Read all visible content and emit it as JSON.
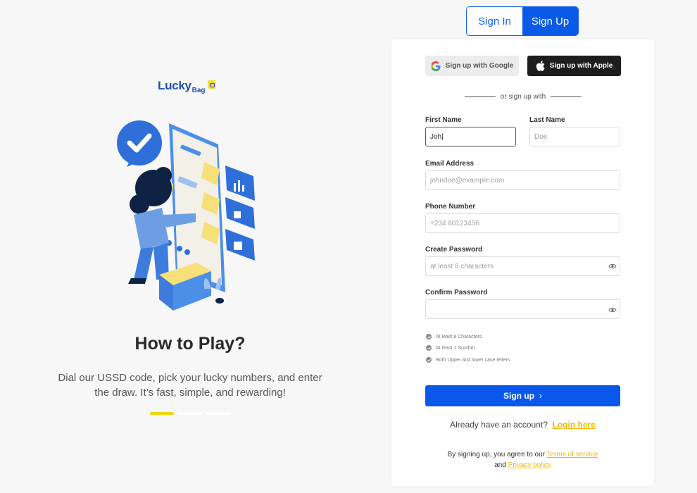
{
  "brand": {
    "name_main": "Lucky",
    "name_sub": "Bag"
  },
  "hero": {
    "title": "How to Play?",
    "description": "Dial our USSD code, pick your lucky numbers, and enter the draw. It’s fast, simple, and rewarding!",
    "carousel_active_index": 0,
    "carousel_count": 3
  },
  "tabs": {
    "signin": "Sign In",
    "signup": "Sign Up",
    "active": "signup"
  },
  "social": {
    "google": "Sign up with Google",
    "apple": "Sign up with Apple"
  },
  "divider": "or sign up with",
  "form": {
    "first_name": {
      "label": "First Name",
      "value": "Joh|",
      "placeholder": ""
    },
    "last_name": {
      "label": "Last Name",
      "placeholder": "Doe"
    },
    "email": {
      "label": "Email Address",
      "placeholder": "johndoe@example.com"
    },
    "phone": {
      "label": "Phone Number",
      "placeholder": "+234 80123456"
    },
    "password": {
      "label": "Create Password",
      "placeholder": "at least 8 characters"
    },
    "confirm": {
      "label": "Confirm Password",
      "placeholder": ""
    }
  },
  "requirements": [
    "At least 8 Characters",
    "At least 1 Number",
    "Both Upper and lower case letters"
  ],
  "submit": {
    "label": "Sign up",
    "chevron": "›"
  },
  "already": {
    "text": "Already have an account?",
    "link": "Login here"
  },
  "terms": {
    "prefix": "By signing up, you agree to our",
    "tos": "Terms of service",
    "and": "and",
    "privacy": "Privacy policy"
  },
  "colors": {
    "primary": "#0a57ec",
    "accent": "#f5d40c",
    "brand": "#1e4fae",
    "link": "#e8b90c"
  }
}
